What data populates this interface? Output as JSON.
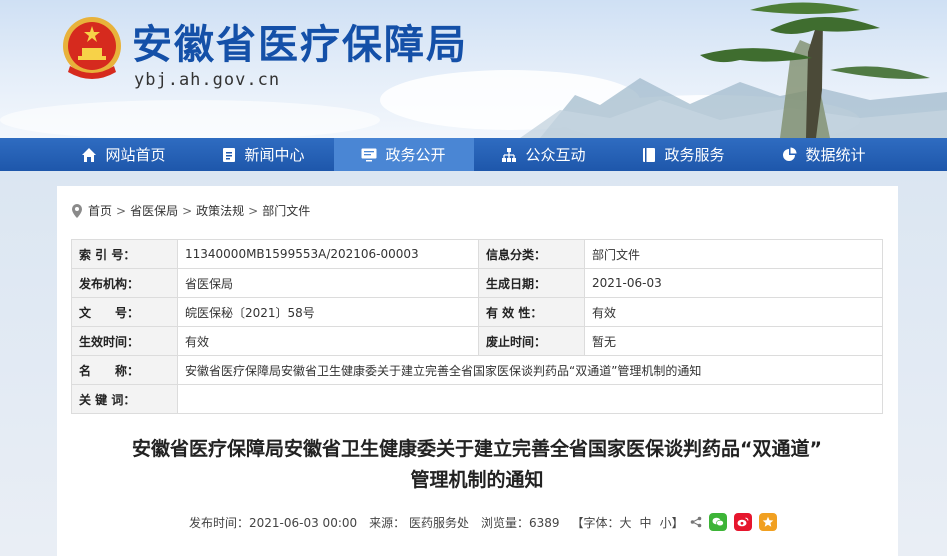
{
  "site": {
    "title": "安徽省医疗保障局",
    "domain": "ybj.ah.gov.cn"
  },
  "nav": {
    "items": [
      {
        "label": "网站首页",
        "icon": "home-icon"
      },
      {
        "label": "新闻中心",
        "icon": "document-icon"
      },
      {
        "label": "政务公开",
        "icon": "monitor-icon",
        "active": true
      },
      {
        "label": "公众互动",
        "icon": "network-icon"
      },
      {
        "label": "政务服务",
        "icon": "book-icon"
      },
      {
        "label": "数据统计",
        "icon": "pie-chart-icon"
      }
    ]
  },
  "breadcrumb": [
    "首页",
    "省医保局",
    "政策法规",
    "部门文件"
  ],
  "meta": {
    "index_label": "索 引 号：",
    "index_value": "11340000MB1599553A/202106-00003",
    "category_label": "信息分类：",
    "category_value": "部门文件",
    "publisher_label": "发布机构：",
    "publisher_value": "省医保局",
    "created_label": "生成日期：",
    "created_value": "2021-06-03",
    "docno_label": "文　　号：",
    "docno_value": "皖医保秘〔2021〕58号",
    "validity_label": "有 效 性：",
    "validity_value": "有效",
    "effective_label": "生效时间：",
    "effective_value": "有效",
    "abolish_label": "废止时间：",
    "abolish_value": "暂无",
    "name_label": "名　　称：",
    "name_value": "安徽省医疗保障局安徽省卫生健康委关于建立完善全省国家医保谈判药品“双通道”管理机制的通知",
    "keywords_label": "关 键 词：",
    "keywords_value": ""
  },
  "article": {
    "title_line1": "安徽省医疗保障局安徽省卫生健康委关于建立完善全省国家医保谈判药品“双通道”",
    "title_line2": "管理机制的通知",
    "publish_time": "发布时间：2021-06-03 00:00",
    "source": "来源： 医药服务处",
    "views": "浏览量：6389",
    "font_label": "【字体：",
    "font_large": "大",
    "font_medium": "中",
    "font_small": "小",
    "font_close": "】"
  },
  "colors": {
    "brand": "#1450a8",
    "nav": "#1e57ab",
    "nav_active": "#4a86d4",
    "wechat": "#3db437",
    "weibo": "#e6162d",
    "favorite": "#f1a021"
  }
}
